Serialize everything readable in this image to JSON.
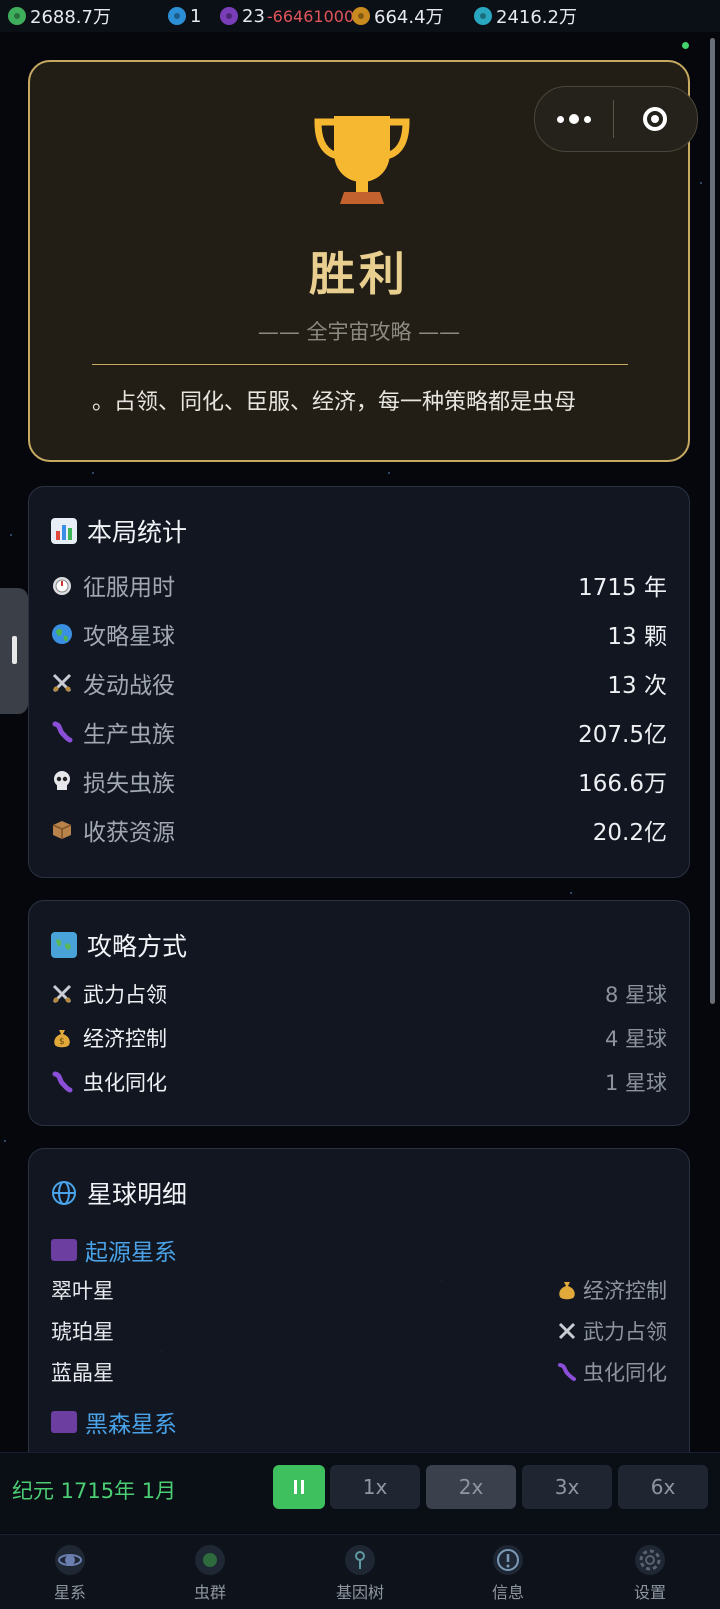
{
  "topbar": {
    "resources": [
      {
        "icon": "biomass-icon",
        "color": "#3fae5c",
        "value": "2688.7万",
        "delta": ""
      },
      {
        "icon": "crystal-icon",
        "color": "#2d8fd6",
        "value": "1",
        "delta": ""
      },
      {
        "icon": "gene-icon",
        "color": "#7a3db8",
        "value": "23",
        "delta": "-66461000"
      },
      {
        "icon": "mineral-icon",
        "color": "#c98a1f",
        "value": "664.4万",
        "delta": ""
      },
      {
        "icon": "energy-icon",
        "color": "#2aa7c0",
        "value": "2416.2万",
        "delta": ""
      }
    ]
  },
  "victory": {
    "title": "胜利",
    "subtitle": "—— 全宇宙攻略 ——",
    "scroll_text": "。占领、同化、臣服、经济，每一种策略都是虫母"
  },
  "stats": {
    "title": "本局统计",
    "rows": [
      {
        "icon": "stopwatch-icon",
        "label": "征服用时",
        "value": "1715 年"
      },
      {
        "icon": "globe-icon",
        "label": "攻略星球",
        "value": "13 颗"
      },
      {
        "icon": "crossed-swords-icon",
        "label": "发动战役",
        "value": "13 次"
      },
      {
        "icon": "worm-icon",
        "label": "生产虫族",
        "value": "207.5亿"
      },
      {
        "icon": "skull-icon",
        "label": "损失虫族",
        "value": "166.6万"
      },
      {
        "icon": "package-icon",
        "label": "收获资源",
        "value": "20.2亿"
      }
    ]
  },
  "methods": {
    "title": "攻略方式",
    "rows": [
      {
        "icon": "crossed-swords-icon",
        "label": "武力占领",
        "value": "8 星球"
      },
      {
        "icon": "money-bag-icon",
        "label": "经济控制",
        "value": "4 星球"
      },
      {
        "icon": "worm-icon",
        "label": "虫化同化",
        "value": "1 星球"
      }
    ]
  },
  "planets": {
    "title": "星球明细",
    "galaxies": [
      {
        "name": "起源星系",
        "planets": [
          {
            "name": "翠叶星",
            "icon": "money-bag-icon",
            "mode": "经济控制"
          },
          {
            "name": "琥珀星",
            "icon": "crossed-swords-icon",
            "mode": "武力占领"
          },
          {
            "name": "蓝晶星",
            "icon": "worm-icon",
            "mode": "虫化同化"
          }
        ]
      },
      {
        "name": "黑森星系",
        "planets": []
      }
    ]
  },
  "speedbar": {
    "era": "纪元 1715年 1月",
    "speeds": [
      "1x",
      "2x",
      "3x",
      "6x"
    ],
    "active_speed": "2x"
  },
  "tabs": [
    {
      "icon": "galaxy-icon",
      "label": "星系"
    },
    {
      "icon": "swarm-icon",
      "label": "虫群"
    },
    {
      "icon": "gene-tree-icon",
      "label": "基因树"
    },
    {
      "icon": "info-icon",
      "label": "信息"
    },
    {
      "icon": "settings-icon",
      "label": "设置"
    }
  ]
}
